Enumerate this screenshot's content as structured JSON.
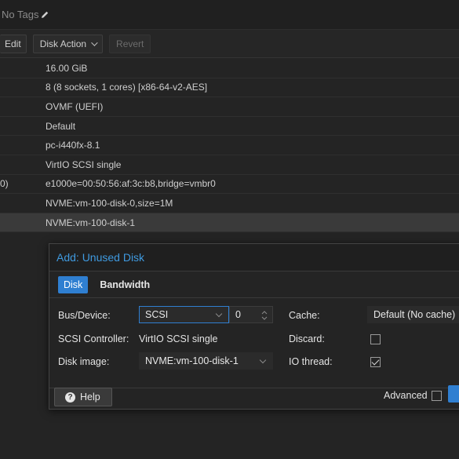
{
  "tagbar": {
    "text": "No Tags",
    "icon": "pencil-icon"
  },
  "toolbar": {
    "edit_label": "Edit",
    "disk_action_label": "Disk Action",
    "revert_label": "Revert"
  },
  "hardware": {
    "rows": [
      {
        "left": "",
        "value": "16.00 GiB"
      },
      {
        "left": "",
        "value": "8 (8 sockets, 1 cores) [x86-64-v2-AES]"
      },
      {
        "left": "",
        "value": "OVMF (UEFI)"
      },
      {
        "left": "",
        "value": "Default"
      },
      {
        "left": "",
        "value": "pc-i440fx-8.1"
      },
      {
        "left": "",
        "value": "VirtIO SCSI single"
      },
      {
        "left": "0)",
        "value": "e1000e=00:50:56:af:3c:b8,bridge=vmbr0"
      },
      {
        "left": "",
        "value": "NVME:vm-100-disk-0,size=1M"
      },
      {
        "left": "",
        "value": "NVME:vm-100-disk-1"
      }
    ]
  },
  "dialog": {
    "title": "Add: Unused Disk",
    "tabs": {
      "disk": "Disk",
      "bandwidth": "Bandwidth"
    },
    "bus_device_label": "Bus/Device:",
    "bus_value": "SCSI",
    "device_index": "0",
    "scsi_controller_label": "SCSI Controller:",
    "scsi_controller_value": "VirtIO SCSI single",
    "disk_image_label": "Disk image:",
    "disk_image_value": "NVME:vm-100-disk-1",
    "cache_label": "Cache:",
    "cache_value": "Default (No cache)",
    "discard_label": "Discard:",
    "discard_checked": false,
    "io_thread_label": "IO thread:",
    "io_thread_checked": true,
    "help_label": "Help",
    "advanced_label": "Advanced",
    "advanced_checked": false
  },
  "colors": {
    "accent": "#2f7fd1",
    "title": "#3f9ae0",
    "background": "#242424"
  }
}
